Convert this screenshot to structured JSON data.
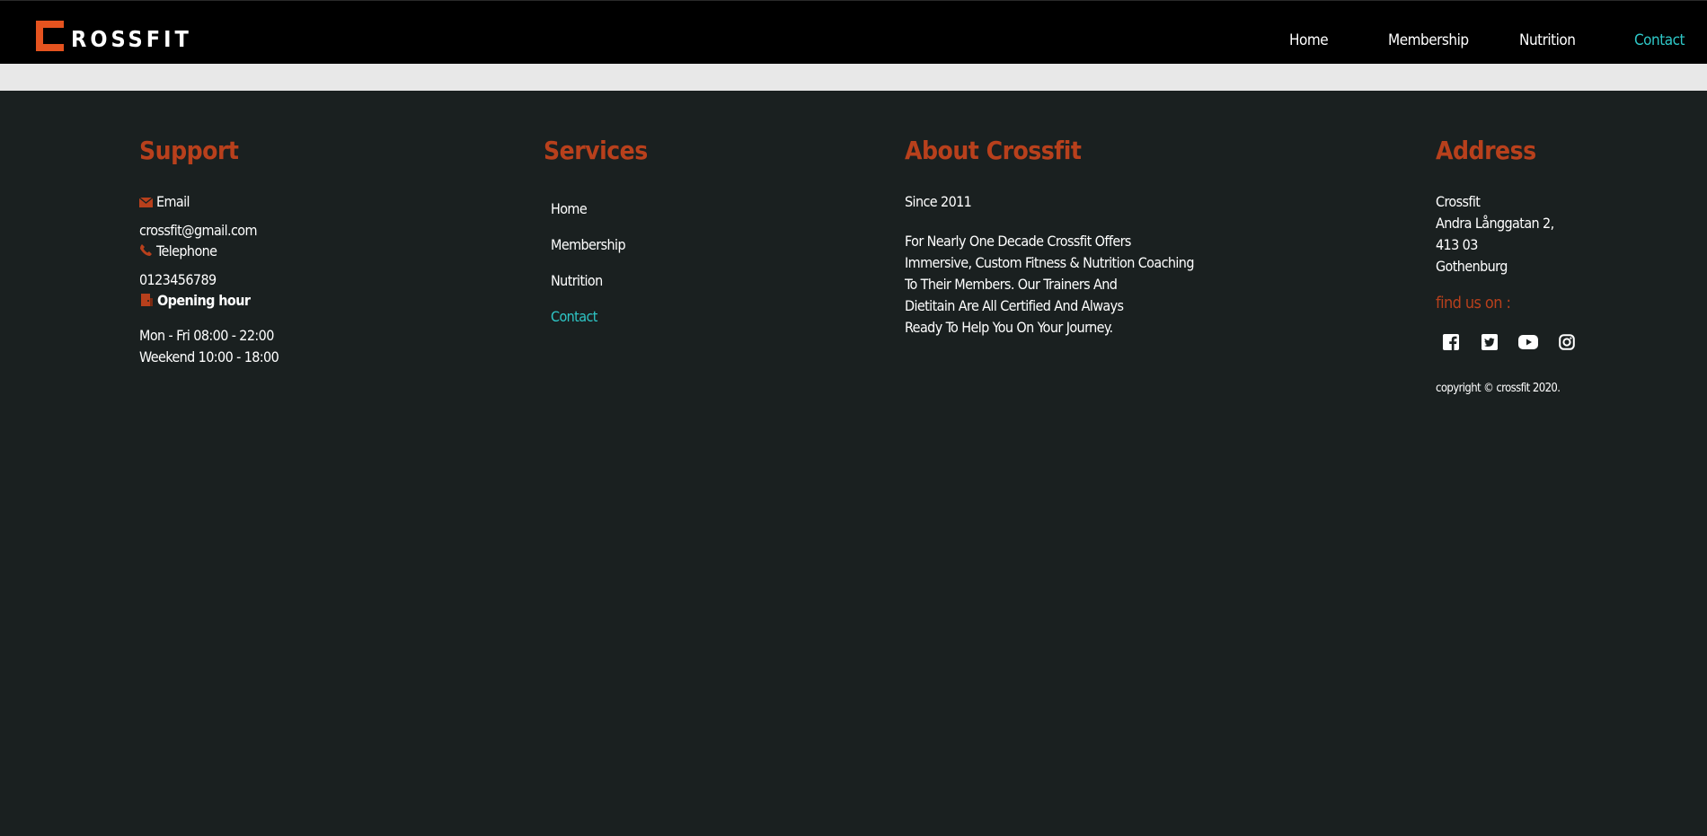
{
  "brand": {
    "logo_text": "ROSSFIT",
    "accent": "#e5531f"
  },
  "nav": {
    "items": [
      {
        "label": "Home",
        "active": false
      },
      {
        "label": "Membership",
        "active": false
      },
      {
        "label": "Nutrition",
        "active": false
      },
      {
        "label": "Contact",
        "active": true
      }
    ],
    "active_color": "#2ec7c7"
  },
  "support": {
    "title": "Support",
    "email_label": "Email",
    "email_icon": "envelope-icon",
    "email_value": "crossfit@gmail.com",
    "phone_label": "Telephone",
    "phone_icon": "phone-icon",
    "phone_value": "0123456789",
    "hours_label": "Opening hour",
    "hours_icon": "door-icon",
    "hours_weekday": "Mon - Fri 08:00 - 22:00",
    "hours_weekend": "Weekend 10:00 - 18:00"
  },
  "services": {
    "title": "Services",
    "links": [
      "Home",
      "Membership",
      "Nutrition",
      "Contact"
    ]
  },
  "about": {
    "title": "About Crossfit",
    "since": "Since 2011",
    "lines": [
      "For Nearly One Decade Crossfit Offers",
      "Immersive, Custom Fitness & Nutrition Coaching",
      "To Their Members. Our Trainers And",
      "Dietitain Are All Certified And Always",
      "Ready To Help You On Your Journey."
    ]
  },
  "address": {
    "title": "Address",
    "lines": [
      "Crossfit",
      "Andra Långgatan 2,",
      "413 03",
      "Gothenburg"
    ],
    "find_us": "find us on :",
    "socials": [
      "facebook-icon",
      "twitter-icon",
      "youtube-icon",
      "instagram-icon"
    ],
    "copyright": "copyright © crossfit 2020."
  },
  "colors": {
    "heading": "#b8401c",
    "background": "#1a2020",
    "strip": "#e8e8e8"
  }
}
